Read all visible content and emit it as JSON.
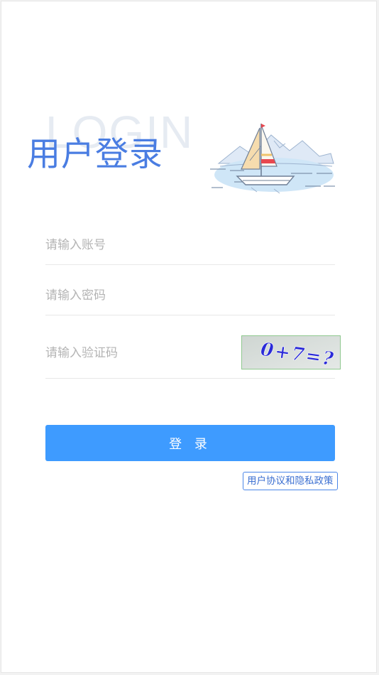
{
  "header": {
    "watermark": "LOGIN",
    "title": "用户登录"
  },
  "form": {
    "account_placeholder": "请输入账号",
    "password_placeholder": "请输入密码",
    "captcha_placeholder": "请输入验证码",
    "captcha_text": "0+7=?"
  },
  "actions": {
    "login_label": "登 录",
    "policy_label": "用户协议和隐私政策"
  },
  "colors": {
    "title": "#4a7de2",
    "primary_button": "#3e9bff",
    "link_border": "#4a86e8"
  }
}
